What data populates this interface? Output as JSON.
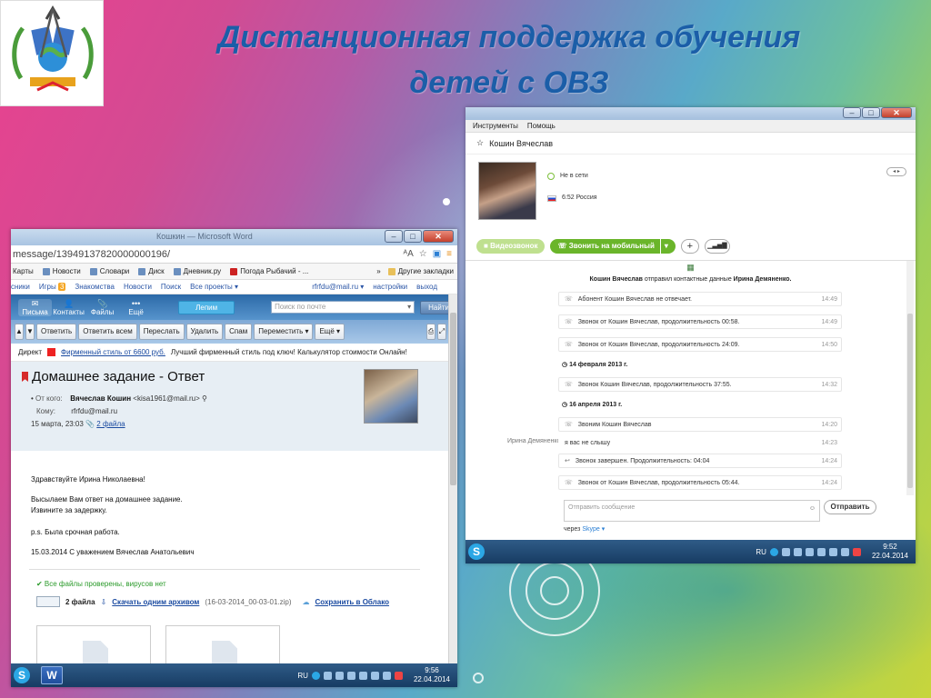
{
  "slide": {
    "title_line1": "Дистанционная поддержка обучения",
    "title_line2": "детей с ОВЗ"
  },
  "mail": {
    "window_title": "Кошкин — Microsoft Word",
    "url": "message/13949137820000000196/",
    "bookmarks": [
      "Карты",
      "Новости",
      "Словари",
      "Диск",
      "Дневник.ру",
      "Погода Рыбачий - ..."
    ],
    "bookmarks_more": "»",
    "bookmarks_other": "Другие закладки",
    "portal_links": [
      "сники",
      "Игры",
      "Знакомства",
      "Новости",
      "Поиск",
      "Все проекты ▾"
    ],
    "games_badge": "3",
    "account": "rfrfdu@mail.ru ▾",
    "settings": "настройки",
    "logout": "выход",
    "nav": [
      {
        "icon": "✉",
        "label": "Письма"
      },
      {
        "icon": "👤",
        "label": "Контакты"
      },
      {
        "icon": "📎",
        "label": "Файлы"
      },
      {
        "icon": "•••",
        "label": "Ещё"
      }
    ],
    "lepim": "Лепим",
    "search_placeholder": "Поиск по почте",
    "find_button": "Найти",
    "toolbar": [
      "Ответить",
      "Ответить всем",
      "Переслать",
      "Удалить",
      "Спам",
      "Переместить ▾",
      "Ещё ▾"
    ],
    "ad": {
      "label": "Директ",
      "link": "Фирменный стиль от 6600 руб.",
      "text": "Лучший фирменный стиль под ключ! Калькулятор стоимости Онлайн!"
    },
    "subject": "Домашнее задание - Ответ",
    "from_label": "От кого:",
    "from_name": "Вячеслав Кошин",
    "from_email": "<kisa1961@mail.ru>",
    "to_label": "Кому:",
    "to": "rfrfdu@mail.ru",
    "date": "15 марта, 23:03",
    "files_link": "2 файла",
    "body": [
      "Здравствуйте Ирина Николаевна!",
      "Высылаем Вам ответ на домашнее задание.",
      "Извините за задержку.",
      "p.s. Была срочная работа.",
      "15.03.2014  С уважением Вячеслав Анатольевич"
    ],
    "virus_check": "✔ Все файлы проверены, вирусов нет",
    "attach_count": "2 файла",
    "download_link": "Скачать одним архивом",
    "archive_name": "(16-03-2014_00-03-01.zip)",
    "cloud_link": "Сохранить в Облако",
    "taskbar": {
      "lang": "RU",
      "time": "9:56",
      "date": "22.04.2014"
    }
  },
  "skype": {
    "menu": [
      "Инструменты",
      "Помощь"
    ],
    "contact_name": "Кошин Вячеслав",
    "status": "Не в сети",
    "local_time": "6:52 Россия",
    "video_button": "Видеозвонок",
    "call_button": "Звонить на мобильный",
    "notice_sender": "Кошин Вячеслав",
    "notice_text": "отправил контактные данные",
    "notice_contact": "Ирина  Демяненко.",
    "messages": [
      {
        "text": "Абонент Кошин Вячеслав не отвечает.",
        "time": "14:49",
        "icon": "☏"
      },
      {
        "text": "Звонок от Кошин Вячеслав, продолжительность 00:58.",
        "time": "14:49",
        "icon": "☏"
      },
      {
        "text": "Звонок от Кошин Вячеслав, продолжительность 24:09.",
        "time": "14:50",
        "icon": "☏"
      },
      {
        "text": "Звонок Кошин Вячеслав, продолжительность 37:55.",
        "time": "14:32",
        "icon": "☏"
      },
      {
        "text": "Звоним Кошин Вячеслав",
        "time": "14:20",
        "icon": "☏"
      },
      {
        "text": "я вас не слышу",
        "time": "14:23",
        "icon": ""
      },
      {
        "text": "Звонок завершен. Продолжительность: 04:04",
        "time": "14:24",
        "icon": "↩"
      },
      {
        "text": "Звонок от Кошин Вячеслав, продолжительность 05:44.",
        "time": "14:24",
        "icon": "☏"
      }
    ],
    "date_sep1": "14 февраля 2013 г.",
    "date_sep2": "16 апреля 2013 г.",
    "sender_me": "Ирина  Демяненко",
    "compose_placeholder": "Отправить сообщение",
    "send_button": "Отправить",
    "via": "через",
    "via_app": "Skype ▾",
    "taskbar": {
      "lang": "RU",
      "time": "9:52",
      "date": "22.04.2014"
    }
  }
}
